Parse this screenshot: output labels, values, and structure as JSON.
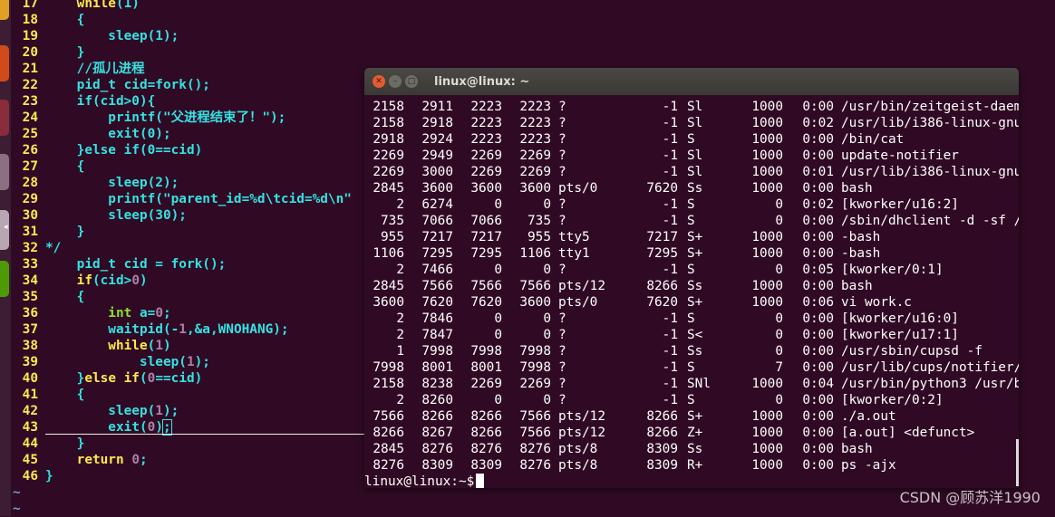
{
  "editor": {
    "lines": [
      {
        "n": "17",
        "parts": [
          [
            "plain",
            "    "
          ],
          [
            "kw",
            "while"
          ],
          [
            "plain",
            "(1)"
          ]
        ]
      },
      {
        "n": "18",
        "parts": [
          [
            "plain",
            "    {"
          ]
        ]
      },
      {
        "n": "19",
        "parts": [
          [
            "plain",
            "        sleep(1);"
          ]
        ]
      },
      {
        "n": "20",
        "parts": [
          [
            "plain",
            "    }"
          ]
        ]
      },
      {
        "n": "21",
        "parts": [
          [
            "plain",
            "    //孤儿进程"
          ]
        ]
      },
      {
        "n": "22",
        "parts": [
          [
            "plain",
            "    pid_t cid=fork();"
          ]
        ]
      },
      {
        "n": "23",
        "parts": [
          [
            "plain",
            "    if(cid>0){"
          ]
        ]
      },
      {
        "n": "24",
        "parts": [
          [
            "plain",
            "        printf(\"父进程结束了！\");"
          ]
        ]
      },
      {
        "n": "25",
        "parts": [
          [
            "plain",
            "        exit(0);"
          ]
        ]
      },
      {
        "n": "26",
        "parts": [
          [
            "plain",
            "    }else if(0==cid)"
          ]
        ]
      },
      {
        "n": "27",
        "parts": [
          [
            "plain",
            "    {"
          ]
        ]
      },
      {
        "n": "28",
        "parts": [
          [
            "plain",
            "        sleep(2);"
          ]
        ]
      },
      {
        "n": "29",
        "parts": [
          [
            "plain",
            "        printf(\"parent_id=%d\\tcid=%d\\n\""
          ]
        ]
      },
      {
        "n": "30",
        "parts": [
          [
            "plain",
            "        sleep(30);"
          ]
        ]
      },
      {
        "n": "31",
        "parts": [
          [
            "plain",
            "    }"
          ]
        ]
      },
      {
        "n": "32",
        "parts": [
          [
            "plain",
            "*/"
          ]
        ]
      },
      {
        "n": "33",
        "parts": [
          [
            "plain",
            "    pid_t cid = fork();"
          ]
        ]
      },
      {
        "n": "34",
        "parts": [
          [
            "kw",
            "    if"
          ],
          [
            "plain",
            "(cid>"
          ],
          [
            "num",
            "0"
          ],
          [
            "plain",
            ")"
          ]
        ]
      },
      {
        "n": "35",
        "parts": [
          [
            "plain",
            "    {"
          ]
        ]
      },
      {
        "n": "36",
        "parts": [
          [
            "ty",
            "        int"
          ],
          [
            "plain",
            " a="
          ],
          [
            "num",
            "0"
          ],
          [
            "plain",
            ";"
          ]
        ]
      },
      {
        "n": "37",
        "parts": [
          [
            "plain",
            "        waitpid(-"
          ],
          [
            "num",
            "1"
          ],
          [
            "plain",
            ",&a,WNOHANG);"
          ]
        ]
      },
      {
        "n": "38",
        "parts": [
          [
            "kw",
            "        while"
          ],
          [
            "plain",
            "("
          ],
          [
            "num",
            "1"
          ],
          [
            "plain",
            ")"
          ]
        ]
      },
      {
        "n": "39",
        "parts": [
          [
            "plain",
            "            sleep("
          ],
          [
            "num",
            "1"
          ],
          [
            "plain",
            ");"
          ]
        ]
      },
      {
        "n": "40",
        "parts": [
          [
            "plain",
            "    }"
          ],
          [
            "kw",
            "else if"
          ],
          [
            "plain",
            "("
          ],
          [
            "num",
            "0"
          ],
          [
            "plain",
            "==cid)"
          ]
        ]
      },
      {
        "n": "41",
        "parts": [
          [
            "plain",
            "    {"
          ]
        ]
      },
      {
        "n": "42",
        "parts": [
          [
            "plain",
            "        sleep("
          ],
          [
            "num",
            "1"
          ],
          [
            "plain",
            ");"
          ]
        ]
      },
      {
        "n": "43",
        "parts": [
          [
            "plain",
            "        exit("
          ],
          [
            "num",
            "0"
          ],
          [
            "plain",
            ")"
          ],
          [
            "cursor",
            ";"
          ]
        ]
      },
      {
        "n": "44",
        "parts": [
          [
            "plain",
            "    }"
          ]
        ]
      },
      {
        "n": "45",
        "parts": [
          [
            "kw",
            "    return"
          ],
          [
            "plain",
            " "
          ],
          [
            "num",
            "0"
          ],
          [
            "plain",
            ";"
          ]
        ]
      },
      {
        "n": "46",
        "parts": [
          [
            "plain",
            "}"
          ]
        ]
      }
    ],
    "tildes": [
      "~",
      "~"
    ]
  },
  "terminal": {
    "title": "linux@linux: ~",
    "rows": [
      [
        "2158",
        "2911",
        "2223",
        "2223",
        "?",
        "-1",
        "Sl",
        "1000",
        "0:00",
        "/usr/bin/zeitgeist-daem"
      ],
      [
        "2158",
        "2918",
        "2223",
        "2223",
        "?",
        "-1",
        "Sl",
        "1000",
        "0:02",
        "/usr/lib/i386-linux-gnu"
      ],
      [
        "2918",
        "2924",
        "2223",
        "2223",
        "?",
        "-1",
        "S",
        "1000",
        "0:00",
        "/bin/cat"
      ],
      [
        "2269",
        "2949",
        "2269",
        "2269",
        "?",
        "-1",
        "Sl",
        "1000",
        "0:00",
        "update-notifier"
      ],
      [
        "2269",
        "3000",
        "2269",
        "2269",
        "?",
        "-1",
        "Sl",
        "1000",
        "0:01",
        "/usr/lib/i386-linux-gnu"
      ],
      [
        "2845",
        "3600",
        "3600",
        "3600",
        "pts/0",
        "7620",
        "Ss",
        "1000",
        "0:00",
        "bash"
      ],
      [
        "2",
        "6274",
        "0",
        "0",
        "?",
        "-1",
        "S",
        "0",
        "0:02",
        "[kworker/u16:2]"
      ],
      [
        "735",
        "7066",
        "7066",
        "735",
        "?",
        "-1",
        "S",
        "0",
        "0:00",
        "/sbin/dhclient -d -sf /"
      ],
      [
        "955",
        "7217",
        "7217",
        "955",
        "tty5",
        "7217",
        "S+",
        "1000",
        "0:00",
        "-bash"
      ],
      [
        "1106",
        "7295",
        "7295",
        "1106",
        "tty1",
        "7295",
        "S+",
        "1000",
        "0:00",
        "-bash"
      ],
      [
        "2",
        "7466",
        "0",
        "0",
        "?",
        "-1",
        "S",
        "0",
        "0:05",
        "[kworker/0:1]"
      ],
      [
        "2845",
        "7566",
        "7566",
        "7566",
        "pts/12",
        "8266",
        "Ss",
        "1000",
        "0:00",
        "bash"
      ],
      [
        "3600",
        "7620",
        "7620",
        "3600",
        "pts/0",
        "7620",
        "S+",
        "1000",
        "0:06",
        "vi work.c"
      ],
      [
        "2",
        "7846",
        "0",
        "0",
        "?",
        "-1",
        "S",
        "0",
        "0:00",
        "[kworker/u16:0]"
      ],
      [
        "2",
        "7847",
        "0",
        "0",
        "?",
        "-1",
        "S<",
        "0",
        "0:00",
        "[kworker/u17:1]"
      ],
      [
        "1",
        "7998",
        "7998",
        "7998",
        "?",
        "-1",
        "Ss",
        "0",
        "0:00",
        "/usr/sbin/cupsd -f"
      ],
      [
        "7998",
        "8001",
        "8001",
        "7998",
        "?",
        "-1",
        "S",
        "7",
        "0:00",
        "/usr/lib/cups/notifier/"
      ],
      [
        "2158",
        "8238",
        "2269",
        "2269",
        "?",
        "-1",
        "SNl",
        "1000",
        "0:04",
        "/usr/bin/python3 /usr/b"
      ],
      [
        "2",
        "8260",
        "0",
        "0",
        "?",
        "-1",
        "S",
        "0",
        "0:00",
        "[kworker/0:2]"
      ],
      [
        "7566",
        "8266",
        "8266",
        "7566",
        "pts/12",
        "8266",
        "S+",
        "1000",
        "0:00",
        "./a.out"
      ],
      [
        "8266",
        "8267",
        "8266",
        "7566",
        "pts/12",
        "8266",
        "Z+",
        "1000",
        "0:00",
        "[a.out] <defunct>"
      ],
      [
        "2845",
        "8276",
        "8276",
        "8276",
        "pts/8",
        "8309",
        "Ss",
        "1000",
        "0:00",
        "bash"
      ],
      [
        "8276",
        "8309",
        "8309",
        "8276",
        "pts/8",
        "8309",
        "R+",
        "1000",
        "0:00",
        "ps -ajx"
      ]
    ],
    "prompt": "linux@linux:~$"
  },
  "watermark": "CSDN @顾苏洋1990"
}
